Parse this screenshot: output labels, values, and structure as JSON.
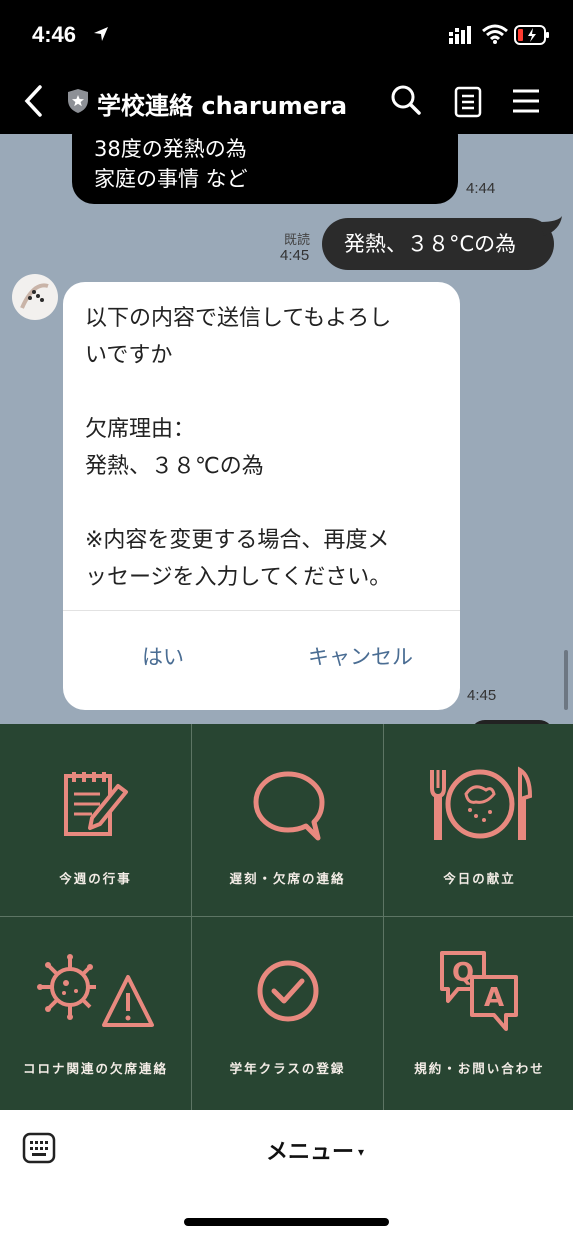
{
  "status_bar": {
    "time": "4:46"
  },
  "header": {
    "title": "学校連絡 charumera"
  },
  "chat": {
    "prev_bubble_lines": [
      "38度の発熱の為",
      "家庭の事情 など"
    ],
    "prev_time": "4:44",
    "read_label": "既読",
    "sent_time": "4:45",
    "sent_message": "発熱、３８°Cの為",
    "confirm_card": {
      "text": "以下の内容で送信してもよろし\nいですか\n\n欠席理由：\n発熱、３８℃の為\n\n※内容を変更する場合、再度メ\nッセージを入力してください。",
      "yes_label": "はい",
      "cancel_label": "キャンセル"
    },
    "card_time": "4:45"
  },
  "rich_menu": {
    "icon_color": "#e8897f",
    "background": "#284532",
    "items": [
      {
        "label": "今週の行事",
        "icon": "notepad-pencil-icon"
      },
      {
        "label": "遅刻・欠席の連絡",
        "icon": "speech-bubble-icon"
      },
      {
        "label": "今日の献立",
        "icon": "fork-plate-knife-icon"
      },
      {
        "label": "コロナ関連の欠席連絡",
        "icon": "virus-warning-icon"
      },
      {
        "label": "学年クラスの登録",
        "icon": "check-circle-icon"
      },
      {
        "label": "規約・お問い合わせ",
        "icon": "qa-bubbles-icon"
      }
    ]
  },
  "bottom_bar": {
    "menu_label": "メニュー",
    "menu_caret": "▾"
  }
}
